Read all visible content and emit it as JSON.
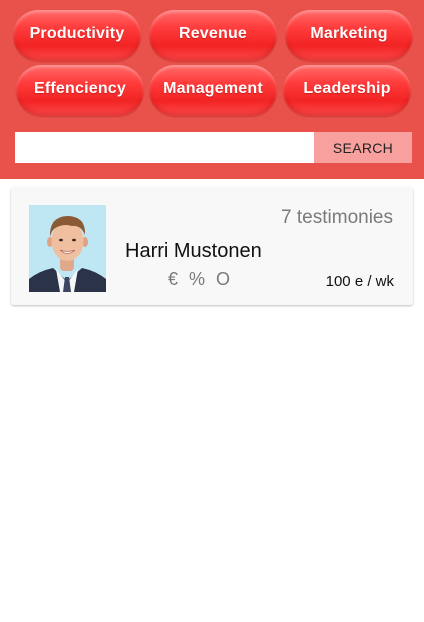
{
  "categories": [
    {
      "label": "Productivity"
    },
    {
      "label": "Revenue"
    },
    {
      "label": "Marketing"
    },
    {
      "label": "Effenciency"
    },
    {
      "label": "Management"
    },
    {
      "label": "Leadership"
    }
  ],
  "search": {
    "value": "",
    "placeholder": "",
    "button_label": "SEARCH"
  },
  "results": [
    {
      "name": "Harri Mustonen",
      "testimonies": "7 testimonies",
      "stats": "€ % O",
      "rate": "100 e / wk"
    }
  ],
  "colors": {
    "header_bg": "#e8524a",
    "category_button": "#ff3b3b",
    "search_button": "#f8a09d"
  }
}
